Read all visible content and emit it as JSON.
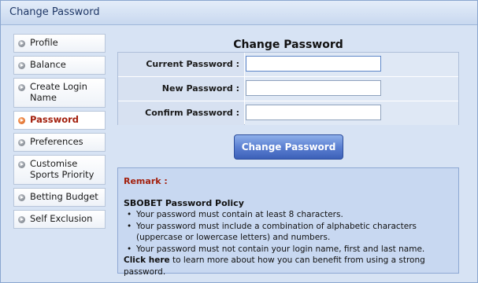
{
  "window": {
    "title": "Change Password"
  },
  "sidebar": {
    "items": [
      {
        "label": "Profile",
        "active": false
      },
      {
        "label": "Balance",
        "active": false
      },
      {
        "label": "Create Login Name",
        "active": false
      },
      {
        "label": "Password",
        "active": true
      },
      {
        "label": "Preferences",
        "active": false
      },
      {
        "label": "Customise Sports Priority",
        "active": false
      },
      {
        "label": "Betting Budget",
        "active": false
      },
      {
        "label": "Self Exclusion",
        "active": false
      }
    ]
  },
  "form": {
    "title": "Change Password",
    "current_label": "Current Password :",
    "new_label": "New Password :",
    "confirm_label": "Confirm Password :",
    "current_value": "",
    "new_value": "",
    "confirm_value": "",
    "submit_label": "Change Password"
  },
  "remark": {
    "heading": "Remark :",
    "policy_title": "SBOBET Password Policy",
    "rules": [
      "Your password must contain at least 8 characters.",
      "Your password must include a combination of alphabetic characters (uppercase or lowercase letters) and numbers.",
      "Your password must not contain your login name, first and last name."
    ],
    "link_text": "Click here",
    "link_suffix": " to learn more about how you can benefit from using a strong password."
  },
  "colors": {
    "accent_red": "#a3200e",
    "button_blue": "#3c60b8",
    "panel_blue": "#c8d8f1"
  },
  "icons": {
    "sidebar_bullet": "arrow-bullet-icon"
  }
}
